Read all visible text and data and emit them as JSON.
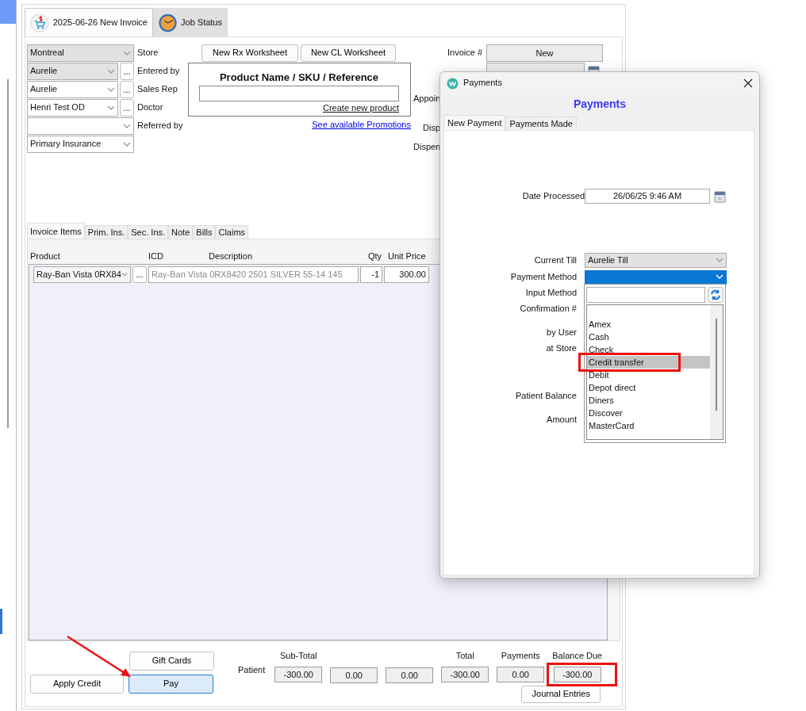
{
  "tabs": [
    {
      "label": "2025-06-26 New Invoice",
      "selected": true
    },
    {
      "label": "Job Status",
      "selected": false
    }
  ],
  "selectors": [
    {
      "value": "Montreal",
      "label": "Store",
      "disabled": true
    },
    {
      "value": "Aurelie",
      "label": "Entered by",
      "more": "...",
      "disabled": true
    },
    {
      "value": "Aurelie",
      "label": "Sales Rep",
      "more": "...",
      "disabled": false
    },
    {
      "value": "Henri Test OD",
      "label": "Doctor",
      "more": "...",
      "disabled": false
    },
    {
      "label": "Referred by",
      "disabled": false
    },
    {
      "value": "Primary Insurance",
      "disabled": false
    }
  ],
  "worksheet_buttons": [
    "New Rx Worksheet",
    "New CL Worksheet"
  ],
  "product_search": {
    "title": "Product Name / SKU / Reference",
    "link": "Create new product"
  },
  "promotions_link": "See available Promotions",
  "invoice_fields": [
    {
      "label": "Invoice #",
      "value": "New",
      "kind": "text"
    },
    {
      "kind": "date"
    },
    {
      "label": "Appoin"
    },
    {
      "label": "Disp"
    },
    {
      "label": "Dispen"
    }
  ],
  "item_tabs": [
    {
      "label": "Invoice Items",
      "selected": true
    },
    {
      "label": "Prim. Ins.",
      "selected": false
    },
    {
      "label": "Sec. Ins.",
      "selected": false
    },
    {
      "label": "Note",
      "selected": false
    },
    {
      "label": "Bills",
      "selected": false
    },
    {
      "label": "Claims",
      "selected": false
    }
  ],
  "table": {
    "columns": [
      "Product",
      "ICD",
      "Description",
      "Qty",
      "Unit Price"
    ],
    "rows": [
      {
        "product": "Ray-Ban Vista 0RX84",
        "more": "...",
        "description": "Ray-Ban Vista 0RX8420 2501 SILVER 55-14 145",
        "qty": "-1",
        "unit_price": "300.00"
      }
    ]
  },
  "actions": [
    {
      "label": "Gift Cards",
      "selected": false
    },
    {
      "label": "Apply Credit",
      "selected": false
    },
    {
      "label": "Pay",
      "selected": true,
      "annotated": true
    }
  ],
  "totals": {
    "row_label": "Patient",
    "values": [
      {
        "header": "Sub-Total",
        "value": "-300.00",
        "highlighted": false
      },
      {
        "value": "0.00",
        "highlighted": false
      },
      {
        "value": "0.00",
        "highlighted": false
      },
      {
        "header": "Total",
        "value": "-300.00",
        "highlighted": false
      },
      {
        "header": "Payments",
        "value": "0.00",
        "highlighted": false
      },
      {
        "header": "Balance Due",
        "value": "-300.00",
        "highlighted": true
      }
    ]
  },
  "journal_button": "Journal Entries",
  "dialog": {
    "title": "Payments",
    "heading": "Payments",
    "tabs": [
      {
        "label": "New Payment",
        "selected": true
      },
      {
        "label": "Payments Made",
        "selected": false
      }
    ],
    "date_processed": {
      "label": "Date Processed",
      "value": "26/06/25 9:46 AM"
    },
    "current_till": {
      "label": "Current Till",
      "value": "Aurelie Till"
    },
    "payment_method": {
      "label": "Payment Method",
      "expanded": true
    },
    "labels": [
      "Input Method",
      "Confirmation #",
      "by User",
      "at Store",
      "Patient Balance",
      "Amount"
    ],
    "options": [
      {
        "label": "Amex",
        "selected": false,
        "highlighted": false
      },
      {
        "label": "Cash",
        "selected": false,
        "highlighted": false
      },
      {
        "label": "Check",
        "selected": false,
        "highlighted": false
      },
      {
        "label": "Credit transfer",
        "selected": true,
        "highlighted": true
      },
      {
        "label": "Debit",
        "selected": false,
        "highlighted": false
      },
      {
        "label": "Depot direct",
        "selected": false,
        "highlighted": false
      },
      {
        "label": "Diners",
        "selected": false,
        "highlighted": false
      },
      {
        "label": "Discover",
        "selected": false,
        "highlighted": false
      },
      {
        "label": "MasterCard",
        "selected": false,
        "highlighted": false
      }
    ]
  }
}
